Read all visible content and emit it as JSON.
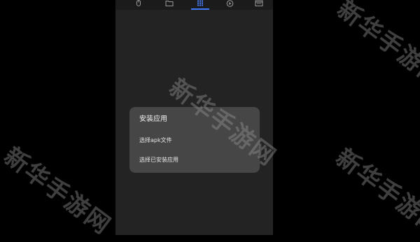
{
  "topbar": {
    "tabs": [
      {
        "icon": "mouse-icon"
      },
      {
        "icon": "folder-icon"
      },
      {
        "icon": "apps-grid-icon",
        "active": true
      },
      {
        "icon": "play-icon"
      },
      {
        "icon": "window-icon"
      }
    ],
    "accent_color": "#3e78ff"
  },
  "dialog": {
    "title": "安装应用",
    "options": [
      {
        "label": "选择apk文件"
      },
      {
        "label": "选择已安装应用"
      }
    ]
  },
  "watermark": {
    "text": "新华手游网"
  }
}
